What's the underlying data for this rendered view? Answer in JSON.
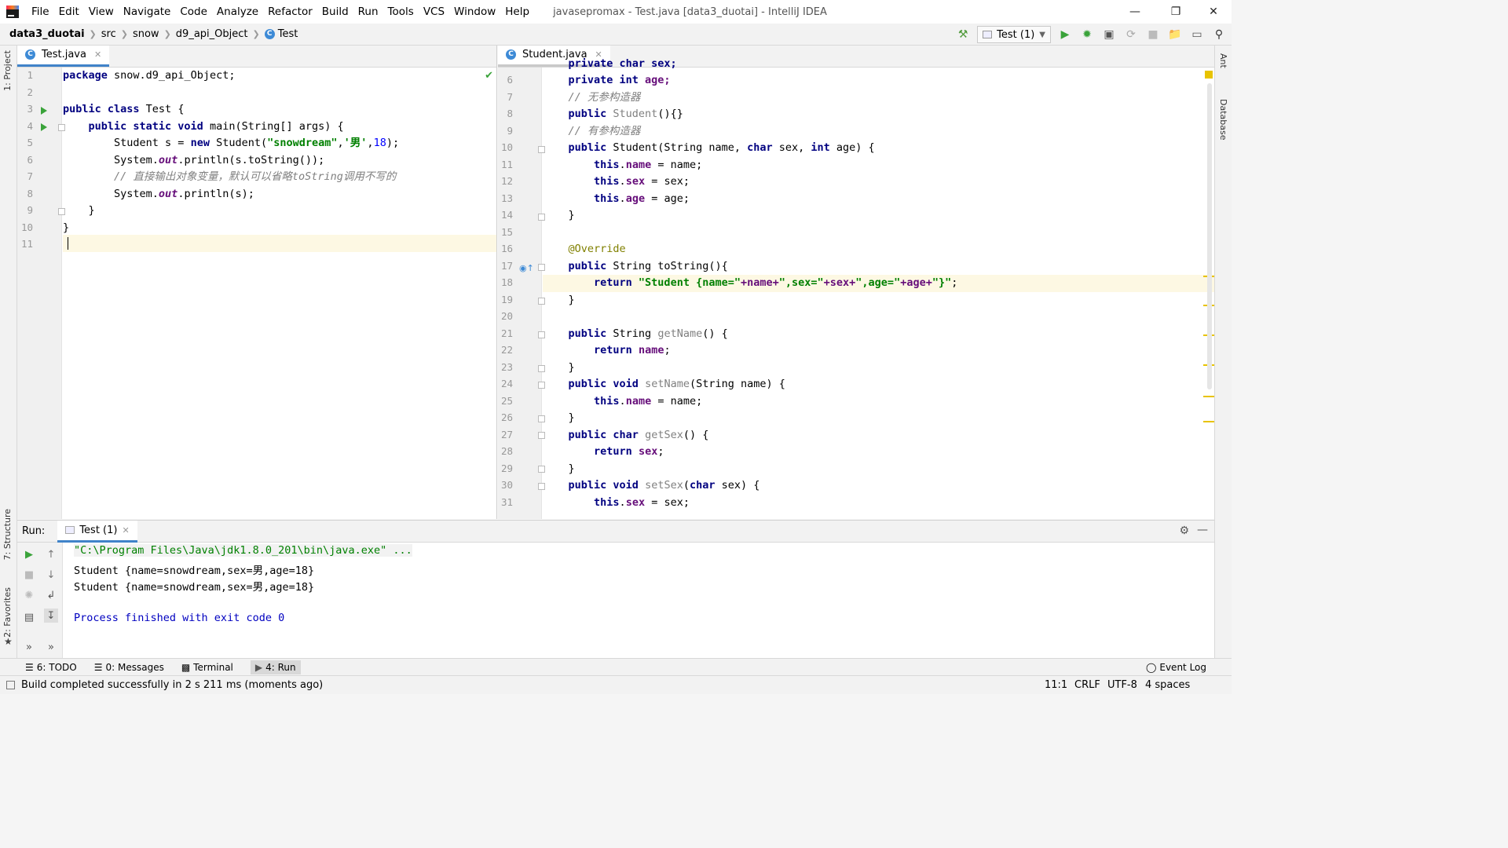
{
  "menu": [
    "File",
    "Edit",
    "View",
    "Navigate",
    "Code",
    "Analyze",
    "Refactor",
    "Build",
    "Run",
    "Tools",
    "VCS",
    "Window",
    "Help"
  ],
  "window_title": "javasepromax - Test.java [data3_duotai] - IntelliJ IDEA",
  "breadcrumb": [
    "data3_duotai",
    "src",
    "snow",
    "d9_api_Object",
    "Test"
  ],
  "run_config": "Test (1)",
  "left_strip": {
    "project": "1: Project",
    "structure": "7: Structure",
    "favorites": "2: Favorites"
  },
  "right_strip": {
    "ant": "Ant",
    "database": "Database"
  },
  "left_editor": {
    "tab": "Test.java",
    "line_numbers": [
      "1",
      "2",
      "3",
      "4",
      "5",
      "6",
      "7",
      "8",
      "9",
      "10",
      "11"
    ],
    "lines": {
      "l1": "package snow.d9_api_Object;",
      "l3a": "public class",
      "l3b": " Test {",
      "l4a": "    public static void",
      "l4b": " main(String[] args) {",
      "l5a": "        Student s = ",
      "l5b": "new",
      "l5c": " Student(",
      "l5d": "\"snowdream\"",
      "l5e": ",",
      "l5f": "'男'",
      "l5g": ",",
      "l5h": "18",
      "l5i": ");",
      "l6a": "        System.",
      "l6b": "out",
      "l6c": ".println(s.toString());",
      "l7": "        // 直接输出对象变量，默认可以省略toString调用不写的",
      "l8a": "        System.",
      "l8b": "out",
      "l8c": ".println(s);",
      "l9": "    }",
      "l10": "}"
    }
  },
  "right_editor": {
    "tab": "Student.java",
    "line_numbers": [
      "6",
      "7",
      "8",
      "9",
      "10",
      "11",
      "12",
      "13",
      "14",
      "15",
      "16",
      "17",
      "18",
      "19",
      "20",
      "21",
      "22",
      "23",
      "24",
      "25",
      "26",
      "27",
      "28",
      "29",
      "30",
      "31"
    ],
    "lines": {
      "l5": "    private char sex;",
      "l6a": "    private int",
      "l6b": " age;",
      "l7": "    // 无参构造器",
      "l8a": "    public",
      "l8b": " Student",
      "l8c": "(){}",
      "l9": "    // 有参构造器",
      "l10a": "    public",
      "l10b": " Student(String name, ",
      "l10c": "char",
      "l10d": " sex, ",
      "l10e": "int",
      "l10f": " age) {",
      "l11a": "        this",
      "l11b": ".",
      "l11c": "name",
      "l11d": " = name;",
      "l12a": "        this",
      "l12b": ".",
      "l12c": "sex",
      "l12d": " = sex;",
      "l13a": "        this",
      "l13b": ".",
      "l13c": "age",
      "l13d": " = age;",
      "l14": "    }",
      "l16": "    @Override",
      "l17a": "    public",
      "l17b": " String toString(){",
      "l18a": "        return",
      "l18b": " \"Student {name=\"",
      "l18c": "+name+",
      "l18d": "\",sex=\"",
      "l18e": "+sex+",
      "l18f": "\",age=\"",
      "l18g": "+age+",
      "l18h": "\"}\"",
      "l18i": ";",
      "l19": "    }",
      "l21a": "    public",
      "l21b": " String ",
      "l21c": "getName",
      "l21d": "() {",
      "l22a": "        return",
      "l22b": " ",
      "l22c": "name",
      "l22d": ";",
      "l23": "    }",
      "l24a": "    public void",
      "l24b": " ",
      "l24c": "setName",
      "l24d": "(String name) {",
      "l25a": "        this",
      "l25b": ".",
      "l25c": "name",
      "l25d": " = name;",
      "l26": "    }",
      "l27a": "    public char",
      "l27b": " ",
      "l27c": "getSex",
      "l27d": "() {",
      "l28a": "        return",
      "l28b": " ",
      "l28c": "sex",
      "l28d": ";",
      "l29": "    }",
      "l30a": "    public void",
      "l30b": " ",
      "l30c": "setSex",
      "l30d": "(",
      "l30e": "char",
      "l30f": " sex) {",
      "l31a": "        this",
      "l31b": ".",
      "l31c": "sex",
      "l31d": " = sex;"
    }
  },
  "run_panel": {
    "label": "Run:",
    "tab": "Test (1)",
    "console": [
      "\"C:\\Program Files\\Java\\jdk1.8.0_201\\bin\\java.exe\" ...",
      "Student {name=snowdream,sex=男,age=18}",
      "Student {name=snowdream,sex=男,age=18}",
      "",
      "Process finished with exit code 0"
    ]
  },
  "bottom_tabs": {
    "todo": "6: TODO",
    "messages": "0: Messages",
    "terminal": "Terminal",
    "run": "4: Run",
    "event_log": "Event Log"
  },
  "status": {
    "message": "Build completed successfully in 2 s 211 ms (moments ago)",
    "position": "11:1",
    "line_sep": "CRLF",
    "encoding": "UTF-8",
    "indent": "4 spaces"
  },
  "colors": {
    "keyword": "#000080",
    "string": "#008000",
    "number": "#0000ff",
    "comment": "#808080",
    "field": "#660e7a",
    "accent": "#4083c9"
  }
}
